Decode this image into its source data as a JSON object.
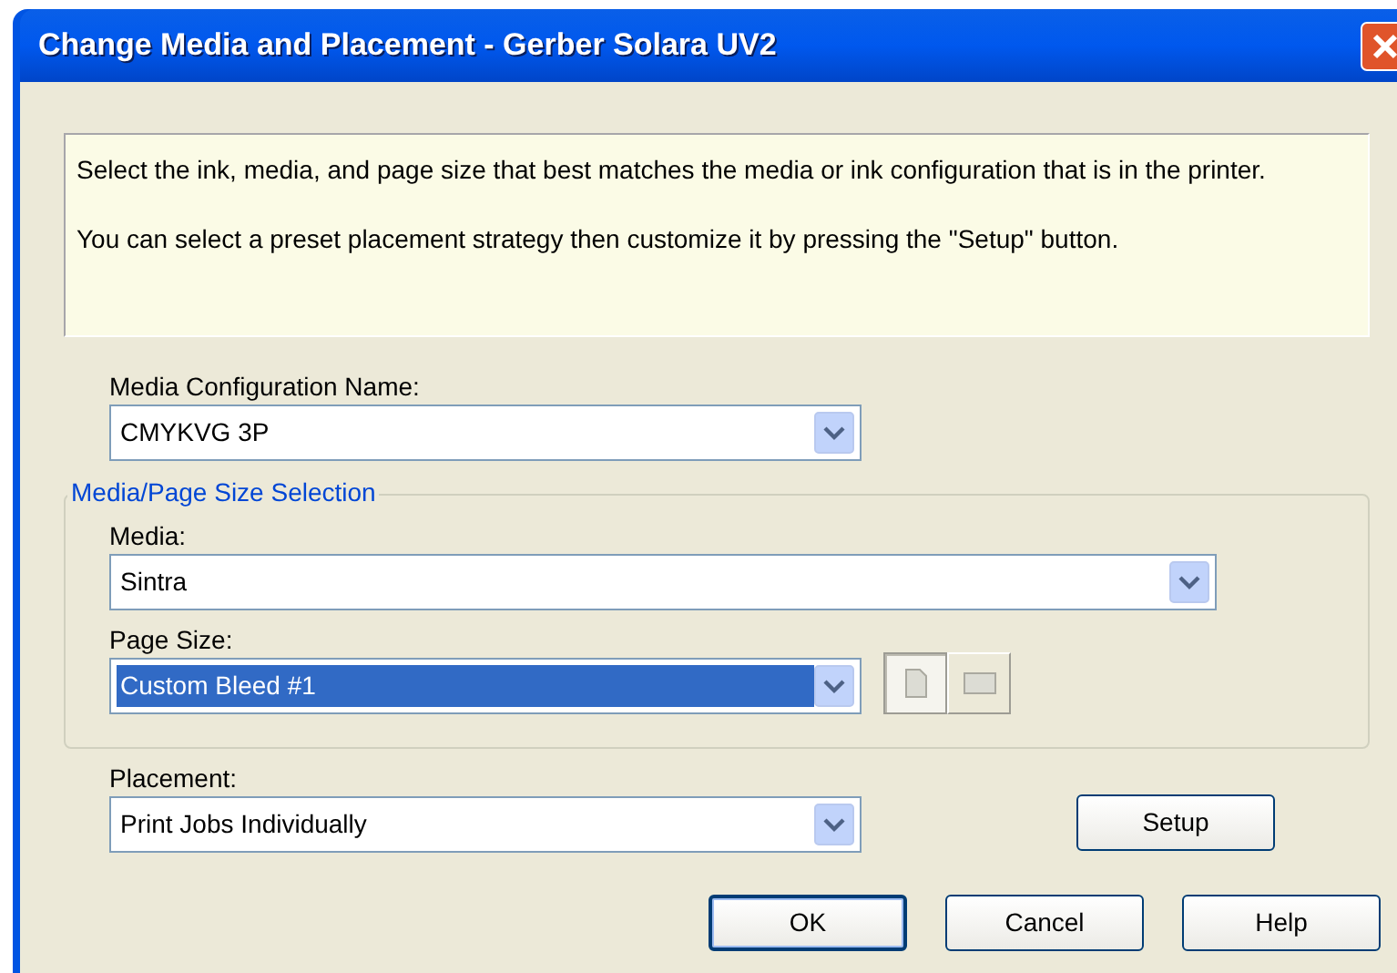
{
  "window": {
    "title": "Change Media and Placement - Gerber Solara UV2"
  },
  "info": [
    "Select the ink, media, and page size that best matches the media or ink configuration that is in the printer.",
    "You can select a preset placement strategy then customize it by pressing the \"Setup\" button."
  ],
  "media_configuration": {
    "label": "Media Configuration Name:",
    "value": "CMYKVG 3P",
    "focused": false
  },
  "group": {
    "legend": "Media/Page Size Selection",
    "media": {
      "label": "Media:",
      "value": "Sintra",
      "focused": false
    },
    "page_size": {
      "label": "Page Size:",
      "value": "Custom Bleed #1",
      "focused": true
    },
    "orientation": [
      {
        "kind": "portrait",
        "selected": true
      },
      {
        "kind": "landscape",
        "selected": false
      }
    ]
  },
  "placement": {
    "label": "Placement:",
    "value": "Print Jobs Individually",
    "focused": false
  },
  "setup_button": "Setup",
  "buttons": [
    {
      "label": "OK",
      "default": true
    },
    {
      "label": "Cancel",
      "default": false
    },
    {
      "label": "Help",
      "default": false
    }
  ]
}
